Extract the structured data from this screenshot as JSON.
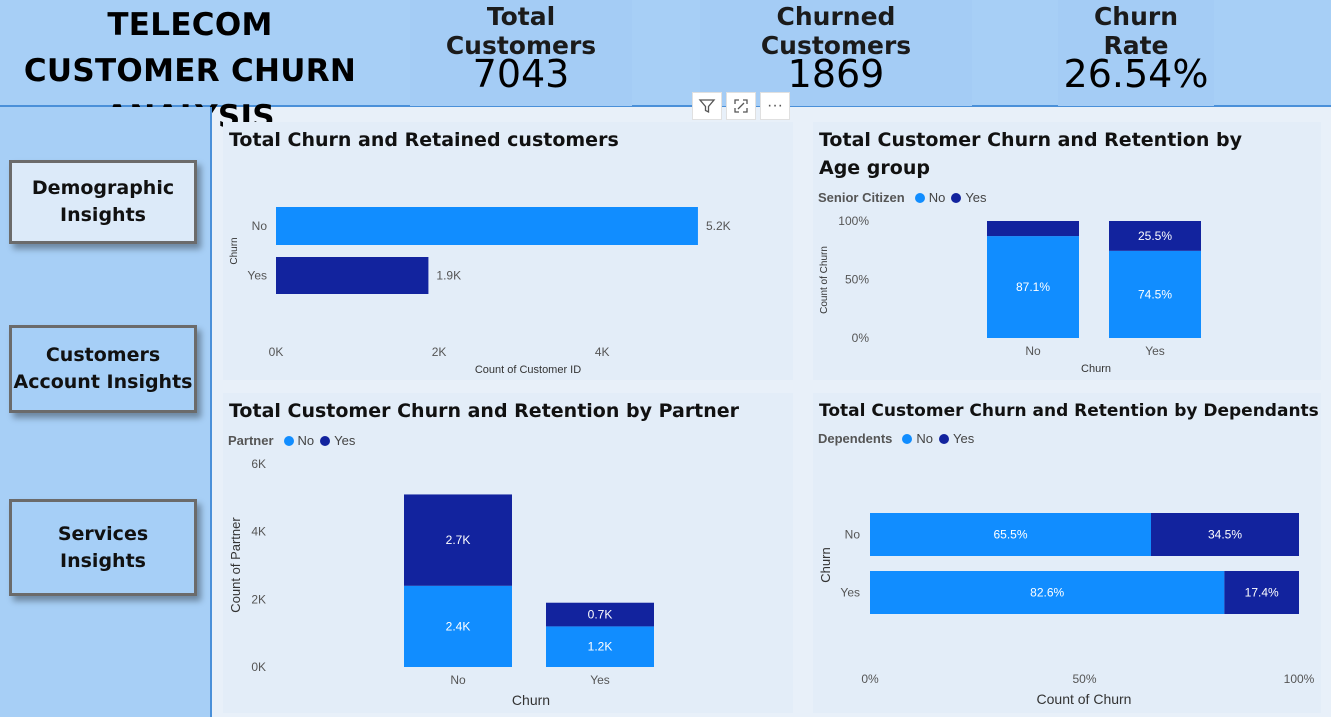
{
  "header": {
    "title": "TELECOM CUSTOMER CHURN  ANALYSIS",
    "kpis": [
      {
        "label": "Total Customers",
        "value": "7043"
      },
      {
        "label": "Churned Customers",
        "value": "1869"
      },
      {
        "label": "Churn Rate",
        "value": "26.54%"
      }
    ]
  },
  "sidebar": {
    "items": [
      {
        "label": "Demographic Insights"
      },
      {
        "label": "Customers Account Insights"
      },
      {
        "label": "Services Insights"
      }
    ]
  },
  "toolbar": {
    "filter_icon": "filter-icon",
    "focus_icon": "focus-mode-icon",
    "more_icon": "more-options-icon",
    "more_label": "···"
  },
  "colors": {
    "no": "#118dff",
    "yes": "#12239e",
    "panel": "#e3edf8",
    "header": "#a7cff6"
  },
  "chart_data": [
    {
      "type": "bar",
      "orientation": "horizontal",
      "title": "Total Churn and Retained customers",
      "categories": [
        "No",
        "Yes"
      ],
      "values": [
        5174,
        1869
      ],
      "data_labels": [
        "5.2K",
        "1.9K"
      ],
      "xlabel": "Count of Customer ID",
      "ylabel": "Churn",
      "xticks": [
        "0K",
        "2K",
        "4K"
      ],
      "xlim": [
        0,
        5600
      ]
    },
    {
      "type": "bar",
      "stacked": "100%",
      "title": "Total Customer Churn and Retention by Age group",
      "legend_title": "Senior Citizen",
      "categories": [
        "No",
        "Yes"
      ],
      "series": [
        {
          "name": "No",
          "values": [
            87.1,
            74.5
          ],
          "labels": [
            "87.1%",
            "74.5%"
          ]
        },
        {
          "name": "Yes",
          "values": [
            12.9,
            25.5
          ],
          "labels": [
            "",
            "25.5%"
          ]
        }
      ],
      "xlabel": "Churn",
      "ylabel": "Count of Churn",
      "yticks": [
        "0%",
        "50%",
        "100%"
      ],
      "ylim": [
        0,
        100
      ]
    },
    {
      "type": "bar",
      "stacked": true,
      "title": "Total Customer Churn and Retention by Partner",
      "legend_title": "Partner",
      "categories": [
        "No",
        "Yes"
      ],
      "series": [
        {
          "name": "No",
          "values": [
            2.4,
            1.2
          ],
          "labels": [
            "2.4K",
            "1.2K"
          ]
        },
        {
          "name": "Yes",
          "values": [
            2.7,
            0.7
          ],
          "labels": [
            "2.7K",
            "0.7K"
          ]
        }
      ],
      "xlabel": "Churn",
      "ylabel": "Count of Partner",
      "yticks": [
        "0K",
        "2K",
        "4K",
        "6K"
      ],
      "ylim": [
        0,
        6
      ]
    },
    {
      "type": "bar",
      "orientation": "horizontal",
      "stacked": "100%",
      "title": "Total Customer Churn and Retention by Dependants",
      "legend_title": "Dependents",
      "categories": [
        "No",
        "Yes"
      ],
      "series": [
        {
          "name": "No",
          "values": [
            65.5,
            82.6
          ],
          "labels": [
            "65.5%",
            "82.6%"
          ]
        },
        {
          "name": "Yes",
          "values": [
            34.5,
            17.4
          ],
          "labels": [
            "34.5%",
            "17.4%"
          ]
        }
      ],
      "xlabel": "Count of Churn",
      "ylabel": "Churn",
      "xticks": [
        "0%",
        "50%",
        "100%"
      ],
      "xlim": [
        0,
        100
      ]
    }
  ]
}
